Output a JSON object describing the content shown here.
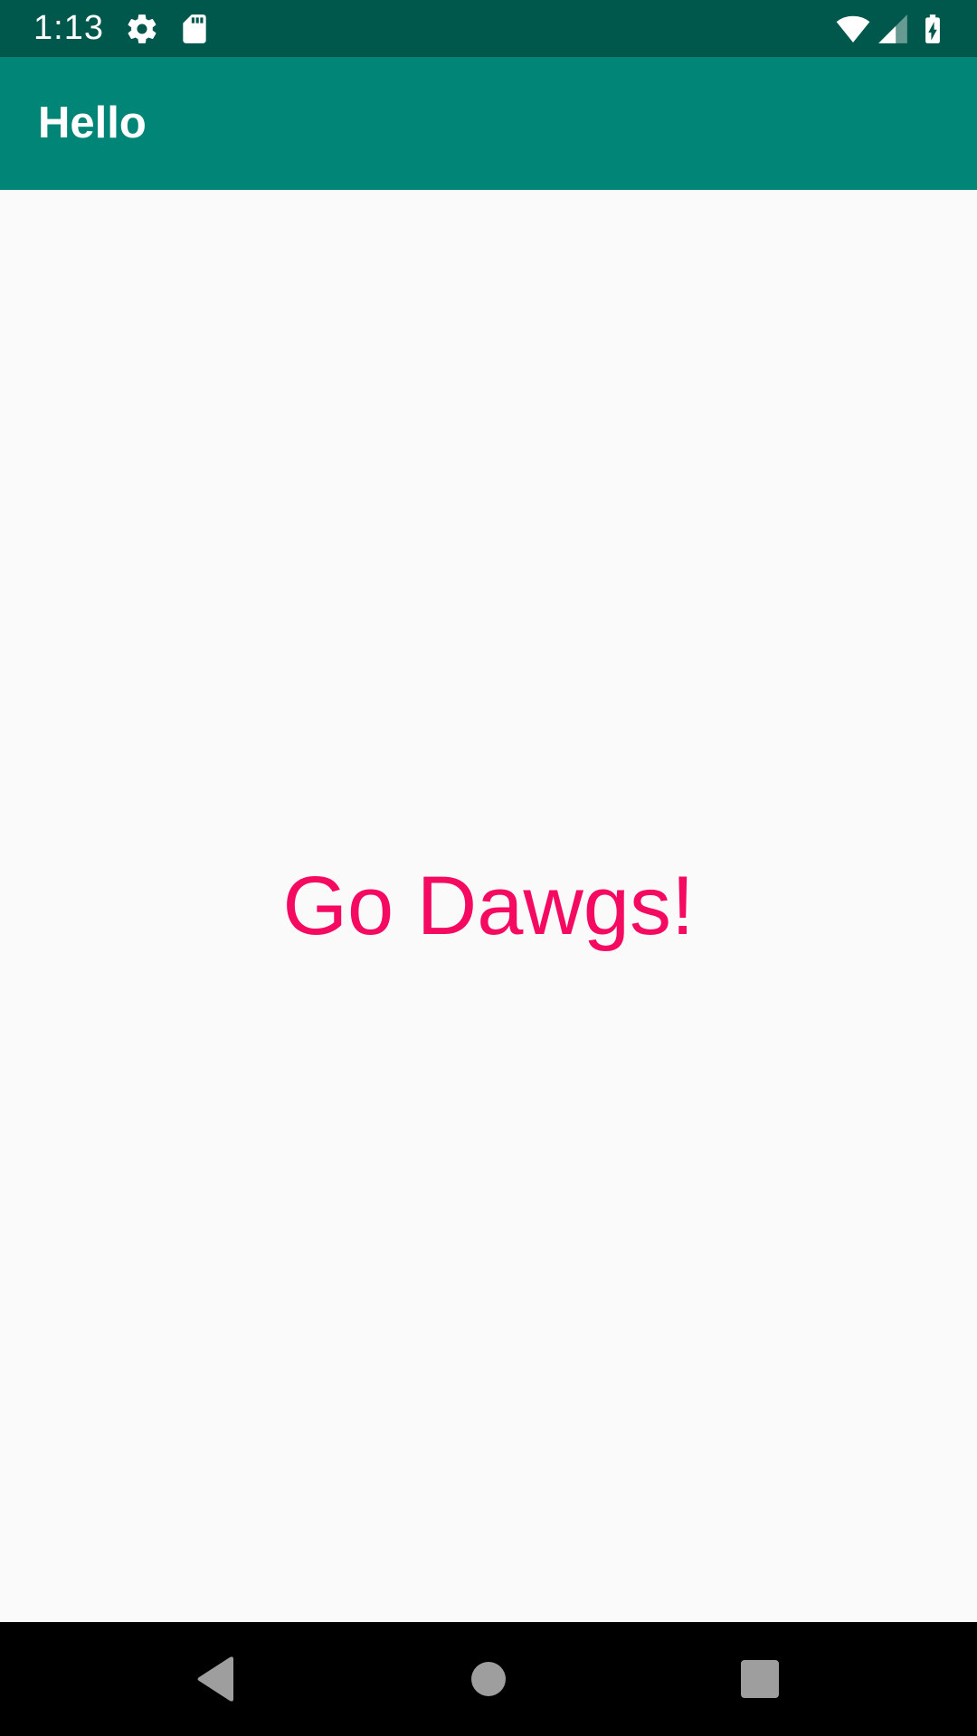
{
  "status_bar": {
    "time": "1:13",
    "icons": [
      "gear-icon",
      "sd-card-icon",
      "wifi-icon",
      "cell-signal-icon",
      "battery-charging-icon"
    ],
    "background": "#00574b"
  },
  "app_bar": {
    "title": "Hello",
    "background": "#008577"
  },
  "main": {
    "text": "Go Dawgs!",
    "text_color": "#f50a62"
  },
  "nav_bar": {
    "buttons": [
      "back-icon",
      "home-icon",
      "recents-icon"
    ]
  }
}
